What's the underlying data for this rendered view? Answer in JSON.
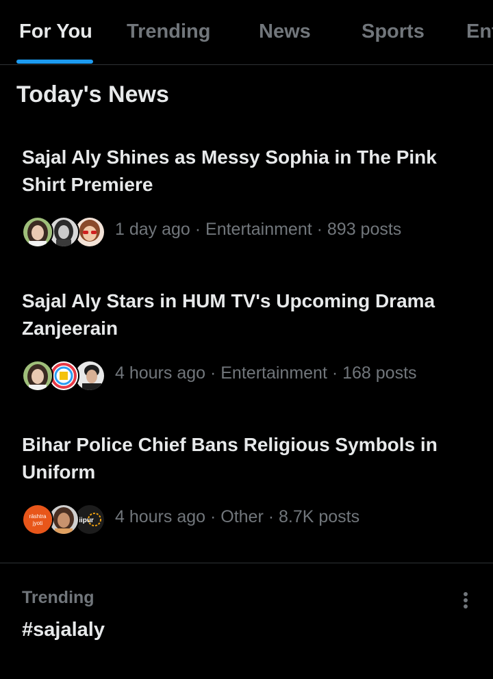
{
  "tabs": [
    {
      "label": "For You",
      "active": true
    },
    {
      "label": "Trending",
      "active": false
    },
    {
      "label": "News",
      "active": false
    },
    {
      "label": "Sports",
      "active": false
    },
    {
      "label": "Ent",
      "active": false
    }
  ],
  "section_title": "Today's News",
  "news": [
    {
      "headline": "Sajal Aly Shines as Messy Sophia in The Pink Shirt Premiere",
      "meta": "1 day ago · Entertainment · 893 posts",
      "avatars": [
        "woman-portrait-avatar",
        "woman-bw-portrait-avatar",
        "woman-sunglasses-avatar"
      ]
    },
    {
      "headline": "Sajal Aly Stars in HUM TV's Upcoming Drama Zanjeerain",
      "meta": "4 hours ago · Entertainment · 168 posts",
      "avatars": [
        "woman-portrait-avatar",
        "hum-tv-logo-avatar",
        "man-portrait-avatar"
      ]
    },
    {
      "headline": "Bihar Police Chief Bans Religious Symbols in Uniform",
      "meta": "4 hours ago · Other · 8.7K posts",
      "avatars": [
        "rashtra-jyoti-logo-avatar",
        "woman-portrait-avatar",
        "news-channel-logo-avatar"
      ]
    }
  ],
  "avatar_text": {
    "rashtra_jyoti_line1": "rāshtra",
    "rashtra_jyoti_line2": "jyoti",
    "channel_logo": "iipur"
  },
  "trending": {
    "label": "Trending",
    "name": "#sajalaly"
  },
  "colors": {
    "background": "#000000",
    "text_primary": "#e7e9ea",
    "text_secondary": "#71767b",
    "accent": "#1d9bf0",
    "divider": "#2f3336"
  }
}
